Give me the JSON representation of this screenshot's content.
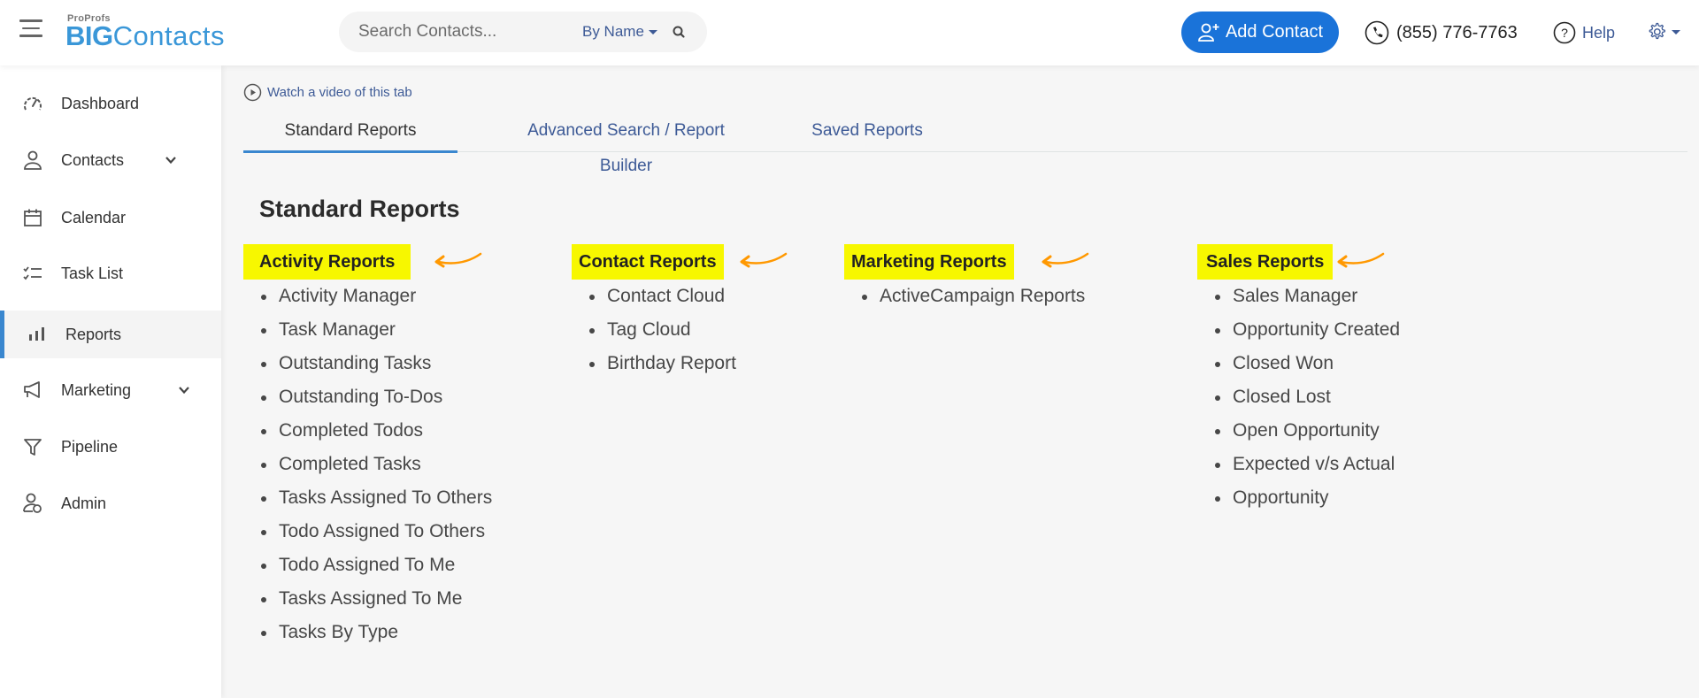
{
  "header": {
    "menu_icon": "hamburger-icon",
    "logo_small": "ProProfs",
    "logo_big_bold": "BIG",
    "logo_big_rest": "Contacts",
    "search_placeholder": "Search Contacts...",
    "search_value": "",
    "search_mode": "By Name",
    "add_contact_label": "Add Contact",
    "phone": "(855) 776-7763",
    "help_label": "Help"
  },
  "sidebar": {
    "items": [
      {
        "label": "Dashboard",
        "icon": "dashboard-gauge-icon"
      },
      {
        "label": "Contacts",
        "icon": "user-icon",
        "expandable": true
      },
      {
        "label": "Calendar",
        "icon": "calendar-icon"
      },
      {
        "label": "Task List",
        "icon": "task-list-icon"
      },
      {
        "label": "Reports",
        "icon": "bar-chart-icon",
        "active": true
      },
      {
        "label": "Marketing",
        "icon": "megaphone-icon",
        "expandable": true
      },
      {
        "label": "Pipeline",
        "icon": "funnel-icon"
      },
      {
        "label": "Admin",
        "icon": "admin-user-icon"
      }
    ]
  },
  "main": {
    "watch_video": "Watch a video of this tab",
    "tabs": [
      {
        "label": "Standard Reports",
        "active": true
      },
      {
        "label": "Advanced Search / Report Builder"
      },
      {
        "label": "Saved Reports"
      }
    ],
    "page_title": "Standard Reports",
    "highlight_color": "#f7f700",
    "arrow_color": "#ff9800",
    "columns": [
      {
        "heading": "Activity Reports",
        "items": [
          "Activity Manager",
          "Task Manager",
          "Outstanding Tasks",
          "Outstanding To-Dos",
          "Completed Todos",
          "Completed Tasks",
          "Tasks Assigned To Others",
          "Todo Assigned To Others",
          "Todo Assigned To Me",
          "Tasks Assigned To Me",
          "Tasks By Type"
        ]
      },
      {
        "heading": "Contact Reports",
        "items": [
          "Contact Cloud",
          "Tag Cloud",
          "Birthday Report"
        ]
      },
      {
        "heading": "Marketing Reports",
        "items": [
          "ActiveCampaign Reports"
        ]
      },
      {
        "heading": "Sales Reports",
        "items": [
          "Sales Manager",
          "Opportunity Created",
          "Closed Won",
          "Closed Lost",
          "Open Opportunity",
          "Expected v/s Actual",
          "Opportunity"
        ]
      }
    ]
  }
}
